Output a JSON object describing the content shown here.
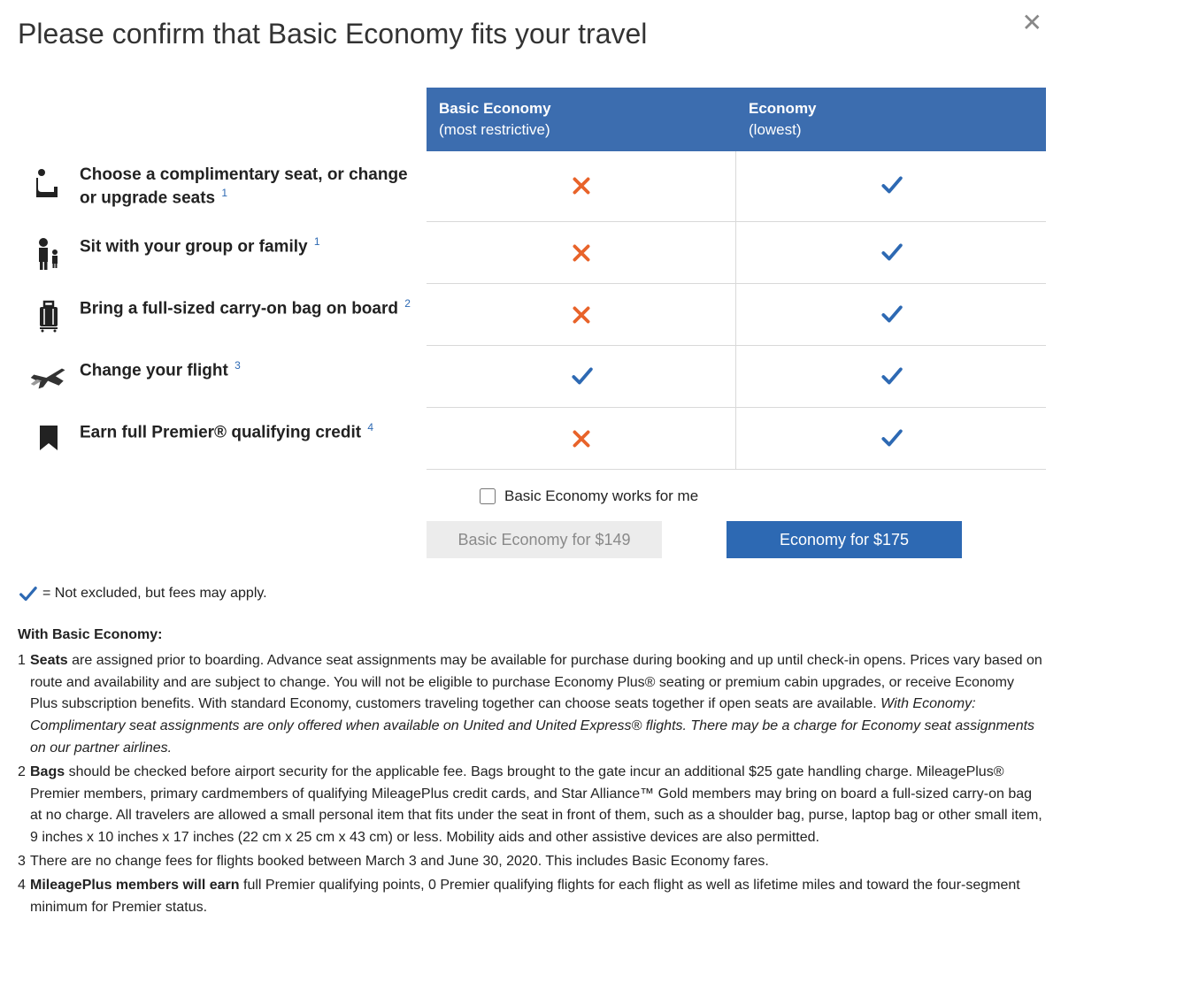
{
  "title": "Please confirm that Basic Economy fits your travel",
  "columns": {
    "basic": {
      "tier": "Basic Economy",
      "sub": "(most restrictive)"
    },
    "economy": {
      "tier": "Economy",
      "sub": "(lowest)"
    }
  },
  "features": [
    {
      "icon": "seat",
      "label": "Choose a complimentary seat, or change or upgrade seats",
      "sup": "1",
      "basic": "x",
      "economy": "check"
    },
    {
      "icon": "family",
      "label": "Sit with your group or family",
      "sup": "1",
      "basic": "x",
      "economy": "check"
    },
    {
      "icon": "bag",
      "label": "Bring a full-sized carry-on bag on board",
      "sup": "2",
      "basic": "x",
      "economy": "check"
    },
    {
      "icon": "plane",
      "label": "Change your flight",
      "sup": "3",
      "basic": "check",
      "economy": "check"
    },
    {
      "icon": "ribbon",
      "label": "Earn full Premier® qualifying credit",
      "sup": "4",
      "basic": "x",
      "economy": "check"
    }
  ],
  "checkbox_label": "Basic Economy works for me",
  "buttons": {
    "basic": "Basic Economy for $149",
    "economy": "Economy for $175"
  },
  "legend_text": " = Not excluded, but fees may apply.",
  "with_heading": "With Basic Economy:",
  "footnotes": {
    "n1_lead": "Seats",
    "n1_rest": " are assigned prior to boarding. Advance seat assignments may be available for purchase during booking and up until check-in opens. Prices vary based on route and availability and are subject to change. You will not be eligible to purchase Economy Plus® seating or premium cabin upgrades, or receive Economy Plus subscription benefits. With standard Economy, customers traveling together can choose seats together if open seats are available. ",
    "n1_italic": "With Economy: Complimentary seat assignments are only offered when available on United and United Express® flights. There may be a charge for Economy seat assignments on our partner airlines.",
    "n2_lead": "Bags",
    "n2_rest": " should be checked before airport security for the applicable fee. Bags brought to the gate incur an additional $25 gate handling charge. MileagePlus® Premier members, primary cardmembers of qualifying MileagePlus credit cards, and Star Alliance™ Gold members may bring on board a full-sized carry-on bag at no charge. All travelers are allowed a small personal item that fits under the seat in front of them, such as a shoulder bag, purse, laptop bag or other small item, 9 inches x 10 inches x 17 inches (22 cm x 25 cm x 43 cm) or less. Mobility aids and other assistive devices are also permitted.",
    "n3": "There are no change fees for flights booked between March 3 and June 30, 2020. This includes Basic Economy fares.",
    "n4_lead": "MileagePlus members will earn",
    "n4_rest": " full Premier qualifying points, 0 Premier qualifying flights for each flight as well as lifetime miles and toward the four-segment minimum for Premier status."
  }
}
